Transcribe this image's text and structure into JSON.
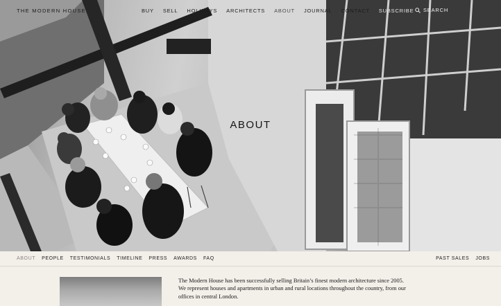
{
  "site": {
    "logo": "THE MODERN HOUSE"
  },
  "nav": {
    "items": [
      {
        "label": "BUY"
      },
      {
        "label": "SELL"
      },
      {
        "label": "HOLIDAYS"
      },
      {
        "label": "ARCHITECTS"
      },
      {
        "label": "ABOUT"
      },
      {
        "label": "JOURNAL"
      },
      {
        "label": "CONTACT"
      },
      {
        "label": "SUBSCRIBE"
      }
    ],
    "search_label": "SEARCH"
  },
  "hero": {
    "title": "ABOUT"
  },
  "subnav": {
    "left": [
      "ABOUT",
      "PEOPLE",
      "TESTIMONIALS",
      "TIMELINE",
      "PRESS",
      "AWARDS",
      "FAQ"
    ],
    "right": [
      "PAST SALES",
      "JOBS"
    ]
  },
  "intro": {
    "text": "The Modern House has been successfully selling Britain’s finest modern architecture since 2005. We represent houses and apartments in urban and rural locations throughout the country, from our offices in central London."
  }
}
